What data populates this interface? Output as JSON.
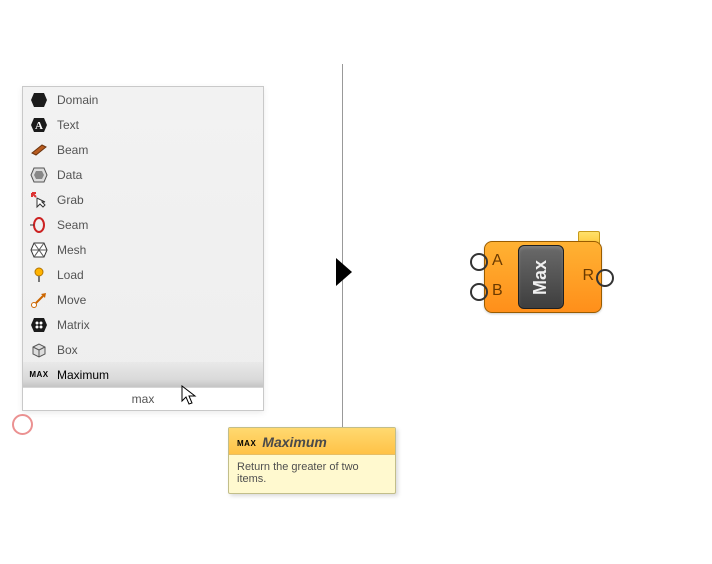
{
  "search": {
    "query": "max",
    "items": [
      {
        "label": "Domain",
        "icon": "hex-dark"
      },
      {
        "label": "Text",
        "icon": "letter-a"
      },
      {
        "label": "Beam",
        "icon": "beam"
      },
      {
        "label": "Data",
        "icon": "hex-outline"
      },
      {
        "label": "Grab",
        "icon": "cursor-x"
      },
      {
        "label": "Seam",
        "icon": "seam"
      },
      {
        "label": "Mesh",
        "icon": "mesh-hex"
      },
      {
        "label": "Load",
        "icon": "pin"
      },
      {
        "label": "Move",
        "icon": "move-arrow"
      },
      {
        "label": "Matrix",
        "icon": "matrix-hex"
      },
      {
        "label": "Box",
        "icon": "box"
      }
    ],
    "selected": {
      "label": "Maximum",
      "icon": "max-badge"
    }
  },
  "tooltip": {
    "title": "Maximum",
    "body": "Return the greater of two items."
  },
  "component": {
    "core_label": "Max",
    "inputs": [
      "A",
      "B"
    ],
    "output": "R"
  }
}
